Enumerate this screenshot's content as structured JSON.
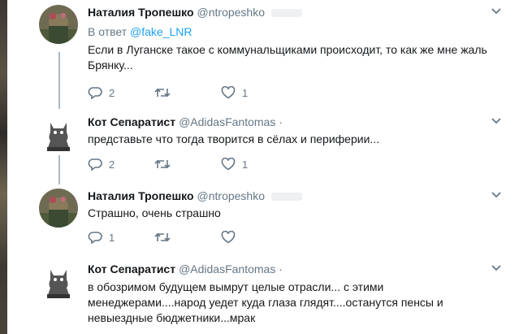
{
  "tweets": [
    {
      "name": "Наталия Тропешко",
      "handle": "@ntropeshko",
      "reply_prefix": "В ответ",
      "reply_handle": "@fake_LNR",
      "text_lines": [
        "Если в Луганске такое с коммунальщиками происходит, то как же мне жаль",
        "Брянку..."
      ],
      "replies": "2",
      "retweets": "",
      "likes": "1"
    },
    {
      "name": "Кот Сепаратист",
      "handle": "@AdidasFantomas",
      "handle_suffix": " ·",
      "text_lines": [
        "представьте что тогда творится в сёлах и периферии..."
      ],
      "replies": "2",
      "retweets": "",
      "likes": "1"
    },
    {
      "name": "Наталия Тропешко",
      "handle": "@ntropeshko",
      "text_lines": [
        "Страшно, очень страшно"
      ],
      "replies": "1",
      "retweets": "",
      "likes": ""
    },
    {
      "name": "Кот Сепаратист",
      "handle": "@AdidasFantomas",
      "handle_suffix": " ·",
      "text_lines": [
        "в обозримом будущем вымрут целые отрасли... с этими",
        "менеджерами....народ уедет куда глаза глядят....останутся пенсы и",
        "невыездные бюджетники...мрак"
      ]
    }
  ],
  "icons": {
    "reply": "reply-icon",
    "retweet": "retweet-icon",
    "like": "heart-icon",
    "more": "chevron-down-icon"
  },
  "colors": {
    "link": "#1da1f2",
    "secondary": "#657786",
    "thread_line": "#aab8c2"
  }
}
